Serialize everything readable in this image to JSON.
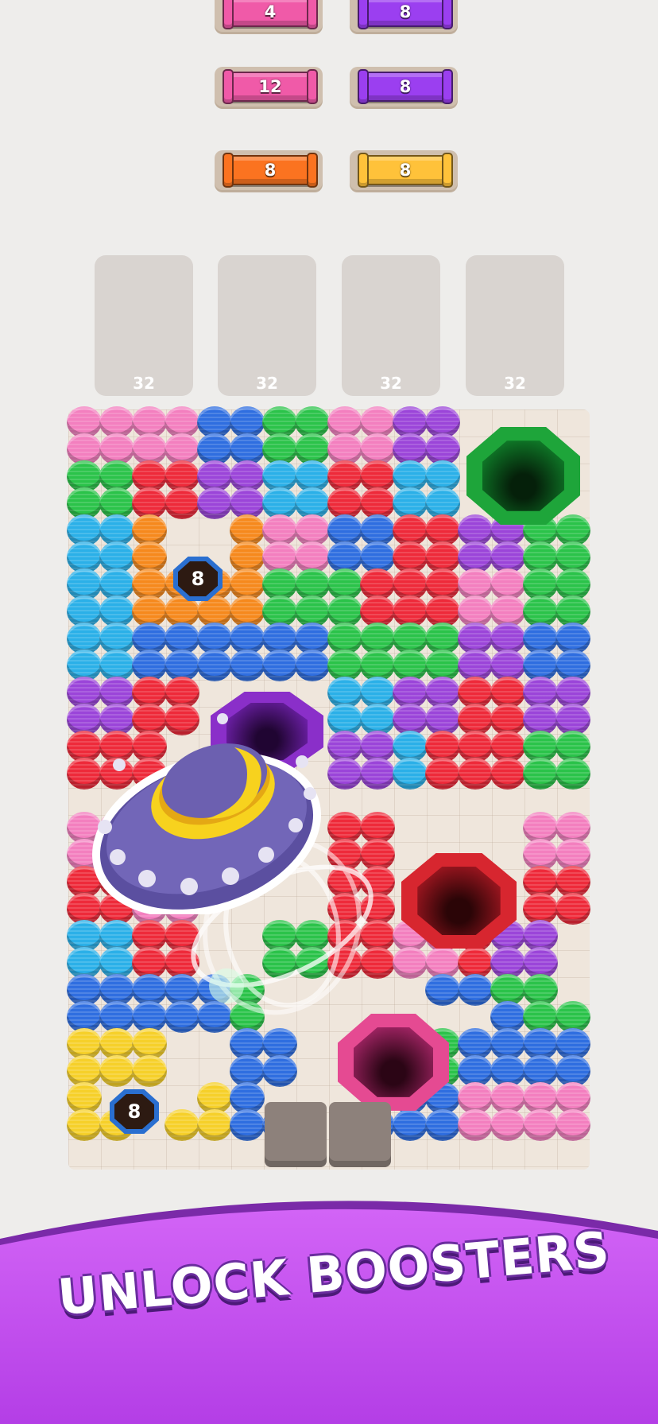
{
  "target_spools": [
    {
      "count": "4",
      "color": "#f05aa8"
    },
    {
      "count": "8",
      "color": "#9b3ff0"
    },
    {
      "count": "12",
      "color": "#f05aa8"
    },
    {
      "count": "8",
      "color": "#9b3ff0"
    },
    {
      "count": "8",
      "color": "#fb7320"
    },
    {
      "count": "8",
      "color": "#ffc23a"
    }
  ],
  "queue_slots": [
    {
      "capacity": "32"
    },
    {
      "capacity": "32"
    },
    {
      "capacity": "32"
    },
    {
      "capacity": "32"
    }
  ],
  "locks": [
    {
      "count": "8"
    },
    {
      "count": "8"
    }
  ],
  "palette": {
    "pink": "#f37fbf",
    "blue": "#2f6ee0",
    "green": "#2bc34a",
    "purple": "#9b45d9",
    "red": "#ee2a3a",
    "cyan": "#2bb0e8",
    "orange": "#f6891d",
    "yellow": "#f6d02a",
    "banner": "#c44cf0"
  },
  "booster_icon": "ufo-icon",
  "banner": {
    "title": "UNLOCK BOOSTERS"
  }
}
